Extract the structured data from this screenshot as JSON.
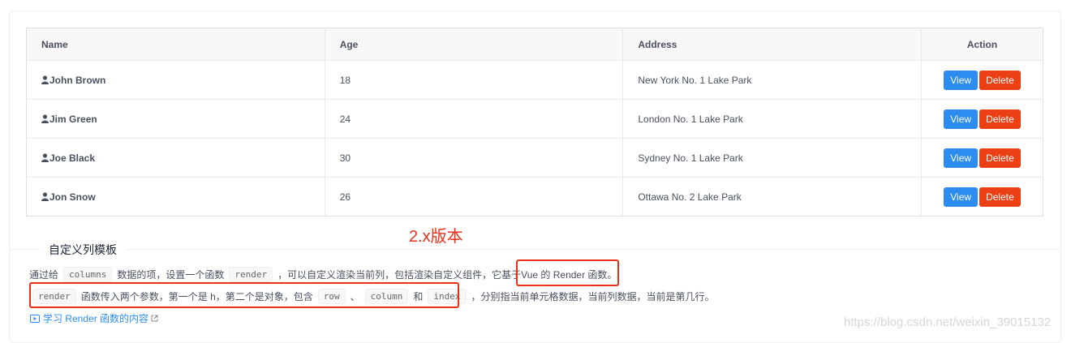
{
  "table": {
    "headers": [
      "Name",
      "Age",
      "Address",
      "Action"
    ],
    "rows": [
      {
        "name": "John Brown",
        "age": "18",
        "address": "New York No. 1 Lake Park"
      },
      {
        "name": "Jim Green",
        "age": "24",
        "address": "London No. 1 Lake Park"
      },
      {
        "name": "Joe Black",
        "age": "30",
        "address": "Sydney No. 1 Lake Park"
      },
      {
        "name": "Jon Snow",
        "age": "26",
        "address": "Ottawa No. 2 Lake Park"
      }
    ],
    "view_label": "View",
    "delete_label": "Delete"
  },
  "version_note": "2.x版本",
  "section": {
    "title": "自定义列模板",
    "desc1": {
      "t1": "通过给",
      "c1": "columns",
      "t2": "数据的项，设置一个函数",
      "c2": "render",
      "t3": "，可以自定义渲染当前列，包括渲染自定义组件，它基于",
      "t4": "Vue 的 Render 函数。"
    },
    "desc2": {
      "c1": "render",
      "t1": "函数传入两个参数，第一个是 h，第二个是对象，包含",
      "c2": "row",
      "sep1": "、",
      "c3": "column",
      "t2": "和",
      "c4": "index",
      "t3": "，分别指当前单元格数据，当前列数据，当前是第几行。"
    },
    "link": "学习 Render 函数的内容"
  },
  "watermark": "https://blog.csdn.net/weixin_39015132",
  "colors": {
    "primary": "#2d8cf0",
    "danger": "#ed3f14",
    "highlight": "#e8311a"
  },
  "icons": {
    "user": "user-icon",
    "video": "video-icon",
    "external": "external-link-icon"
  }
}
